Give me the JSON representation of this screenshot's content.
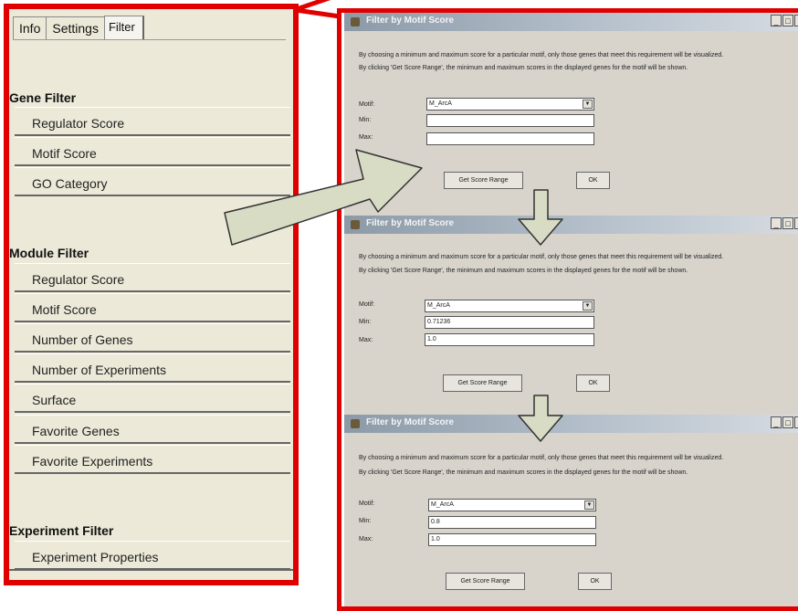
{
  "tabs": [
    {
      "label": "Info"
    },
    {
      "label": "Settings"
    },
    {
      "label": "Filter"
    }
  ],
  "gene_filter": {
    "title": "Gene Filter",
    "items": [
      "Regulator Score",
      "Motif Score",
      "GO Category"
    ]
  },
  "module_filter": {
    "title": "Module Filter",
    "items": [
      "Regulator Score",
      "Motif Score",
      "Number of Genes",
      "Number of Experiments",
      "Surface",
      "Favorite Genes",
      "Favorite Experiments"
    ]
  },
  "experiment_filter": {
    "title": "Experiment Filter",
    "items": [
      "Experiment Properties"
    ]
  },
  "windows": [
    {
      "title": "Filter by Motif Score",
      "desc1": "By choosing a minimum and maximum score for a particular motif, only those genes that meet this requirement will be visualized.",
      "desc2": "By clicking 'Get Score Range', the minimum and maximum scores in the displayed genes for the motif will be shown.",
      "motif_label": "Motif:",
      "min_label": "Min:",
      "max_label": "Max:",
      "motif_value": "M_ArcA",
      "min_value": "",
      "max_value": "",
      "get_range_label": "Get Score Range",
      "ok_label": "OK"
    },
    {
      "title": "Filter by Motif Score",
      "desc1": "By choosing a minimum and maximum score for a particular motif, only those genes that meet this requirement will be visualized.",
      "desc2": "By clicking 'Get Score Range', the minimum and maximum scores in the displayed genes for the motif will be shown.",
      "motif_label": "Motif:",
      "min_label": "Min:",
      "max_label": "Max:",
      "motif_value": "M_ArcA",
      "min_value": "0.71236",
      "max_value": "1.0",
      "get_range_label": "Get Score Range",
      "ok_label": "OK"
    },
    {
      "title": "Filter by Motif Score",
      "desc1": "By choosing a minimum and maximum score for a particular motif, only those genes that meet this requirement will be visualized.",
      "desc2": "By clicking 'Get Score Range', the minimum and maximum scores in the displayed genes for the motif will be shown.",
      "motif_label": "Motif:",
      "min_label": "Min:",
      "max_label": "Max:",
      "motif_value": "M_ArcA",
      "min_value": "0.8",
      "max_value": "1.0",
      "get_range_label": "Get Score Range",
      "ok_label": "OK"
    }
  ],
  "colors": {
    "frame": "#e00000",
    "arrow_fill": "#d8dcc4",
    "titlebar": "#8c9aa8"
  }
}
